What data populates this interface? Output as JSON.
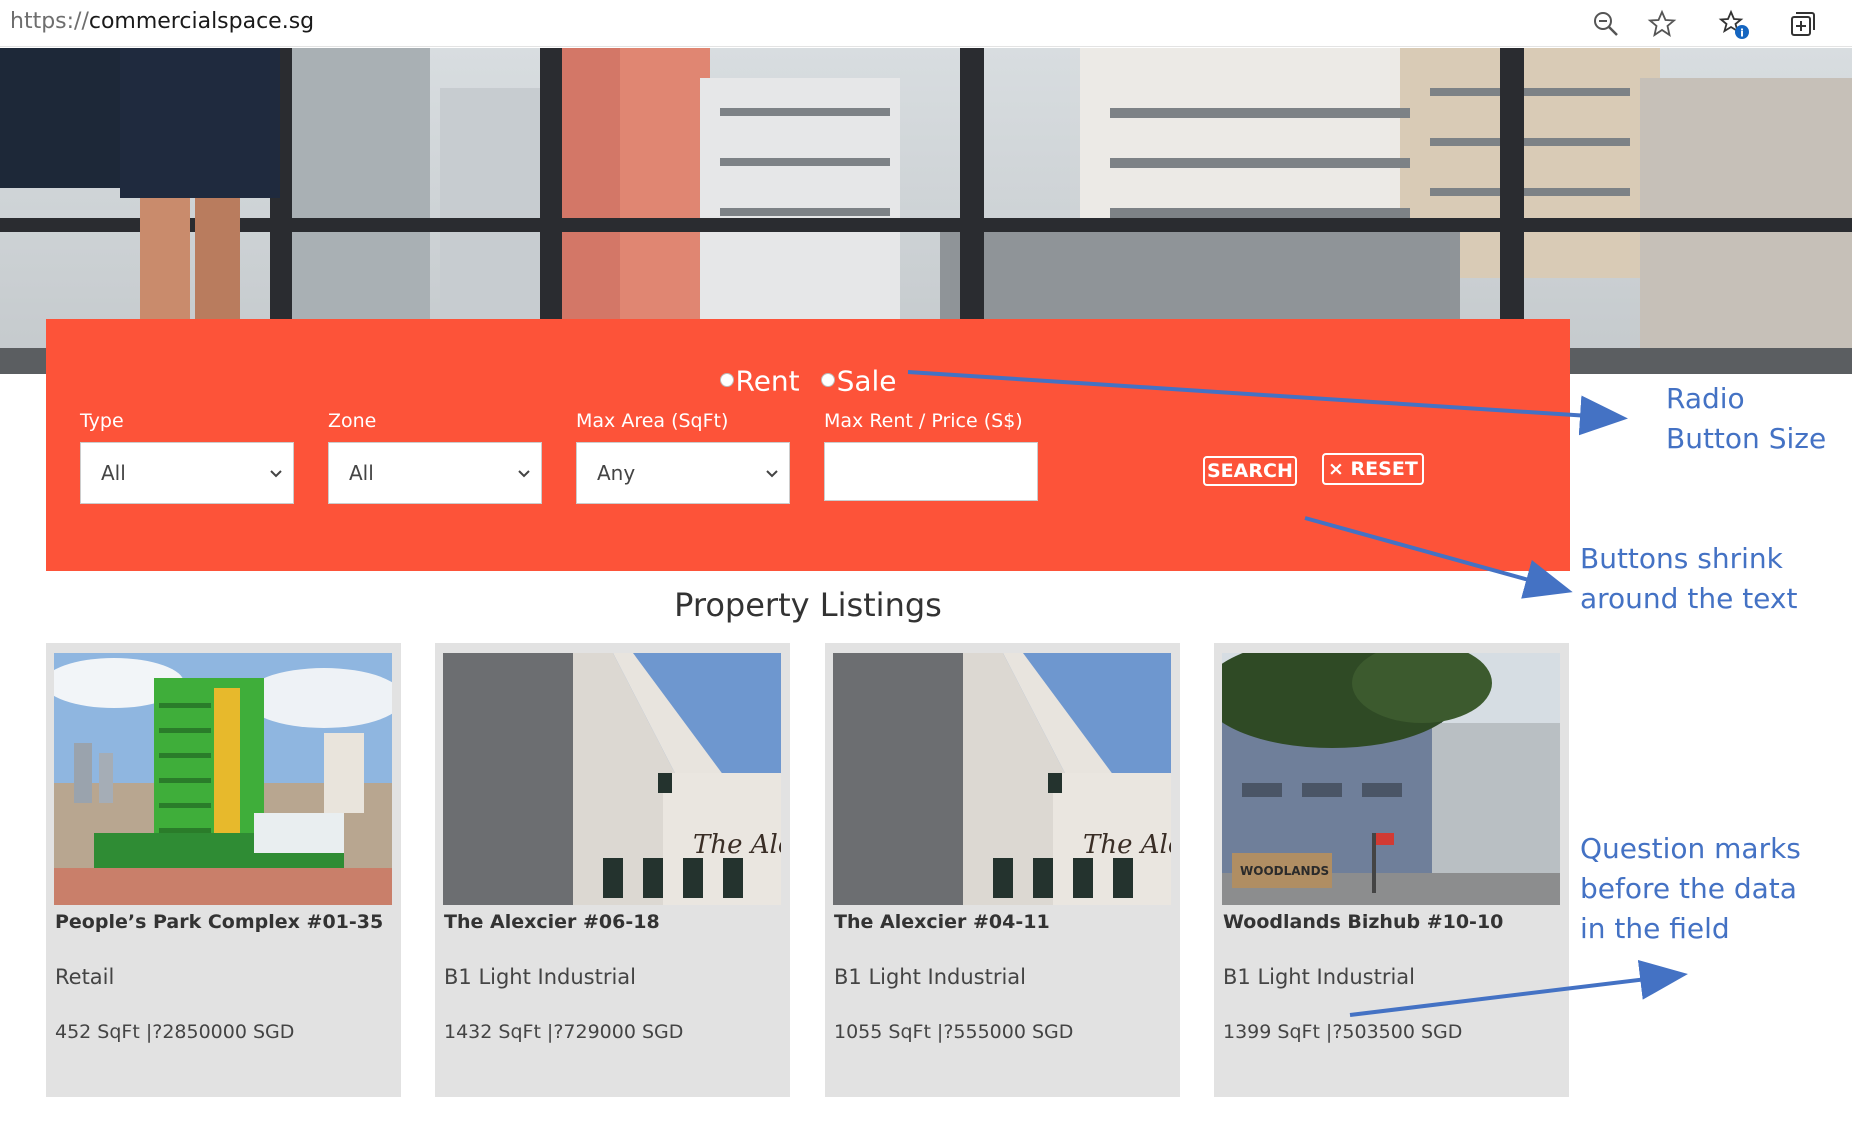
{
  "browser": {
    "url_scheme": "https://",
    "url_host": "commercialspace.sg",
    "icons": [
      "zoom-icon",
      "favorite-star-icon",
      "favorites-list-icon",
      "collections-icon"
    ]
  },
  "search": {
    "radio_options": [
      {
        "label": "Rent"
      },
      {
        "label": "Sale"
      }
    ],
    "fields": [
      {
        "label": "Type",
        "value": "All"
      },
      {
        "label": "Zone",
        "value": "All"
      },
      {
        "label": "Max Area (SqFt)",
        "value": "Any"
      },
      {
        "label": "Max Rent / Price (S$)",
        "value": ""
      }
    ],
    "search_label": "SEARCH",
    "reset_label": "RESET",
    "reset_icon": "×",
    "panel_color": "#fd5339"
  },
  "listings": {
    "title": "Property Listings",
    "cards": [
      {
        "name": "People’s Park Complex #01-35",
        "type": "Retail",
        "info": "452 SqFt |?2850000 SGD"
      },
      {
        "name": "The Alexcier #06-18",
        "type": "B1 Light Industrial",
        "info": "1432 SqFt |?729000 SGD"
      },
      {
        "name": "The Alexcier #04-11",
        "type": "B1 Light Industrial",
        "info": "1055 SqFt |?555000 SGD"
      },
      {
        "name": "Woodlands Bizhub #10-10",
        "type": "B1 Light Industrial",
        "info": "1399 SqFt |?503500 SGD"
      }
    ]
  },
  "annotations": {
    "radio": [
      "Radio",
      "Button Size"
    ],
    "buttons": [
      "Buttons shrink",
      "around the text"
    ],
    "question": [
      "Question marks",
      "before the data",
      "in the field"
    ],
    "color": "#4472c4"
  }
}
